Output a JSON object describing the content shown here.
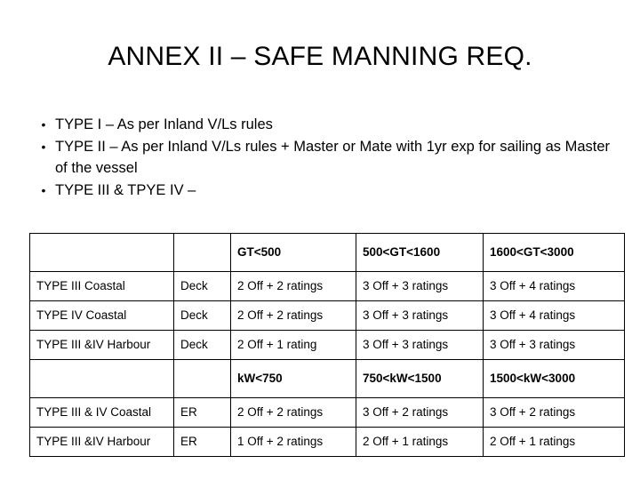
{
  "slide": {
    "title": "ANNEX II – SAFE MANNING REQ.",
    "bullet_marker": "•",
    "bullets": [
      "TYPE I – As per Inland V/Ls rules",
      "TYPE II – As per Inland V/Ls rules + Master or Mate with 1yr exp for sailing as Master of the vessel",
      "TYPE III & TPYE IV –"
    ]
  },
  "table": {
    "deck_header": [
      "",
      "",
      "GT<500",
      "500<GT<1600",
      "1600<GT<3000"
    ],
    "deck_rows": [
      [
        "TYPE III Coastal",
        "Deck",
        "2 Off + 2 ratings",
        "3 Off + 3 ratings",
        "3 Off + 4 ratings"
      ],
      [
        "TYPE IV Coastal",
        "Deck",
        "2 Off + 2 ratings",
        "3 Off + 3 ratings",
        "3 Off + 4 ratings"
      ],
      [
        "TYPE III &IV Harbour",
        "Deck",
        "2 Off + 1 rating",
        "3 Off + 3 ratings",
        "3 Off + 3 ratings"
      ]
    ],
    "er_header": [
      "",
      "",
      "kW<750",
      "750<kW<1500",
      "1500<kW<3000"
    ],
    "er_rows": [
      [
        "TYPE III & IV Coastal",
        "ER",
        "2 Off + 2 ratings",
        "3 Off + 2 ratings",
        "3 Off + 2 ratings"
      ],
      [
        "TYPE III &IV Harbour",
        "ER",
        "1 Off + 2 ratings",
        "2 Off + 1 ratings",
        "2 Off + 1 ratings"
      ]
    ]
  }
}
